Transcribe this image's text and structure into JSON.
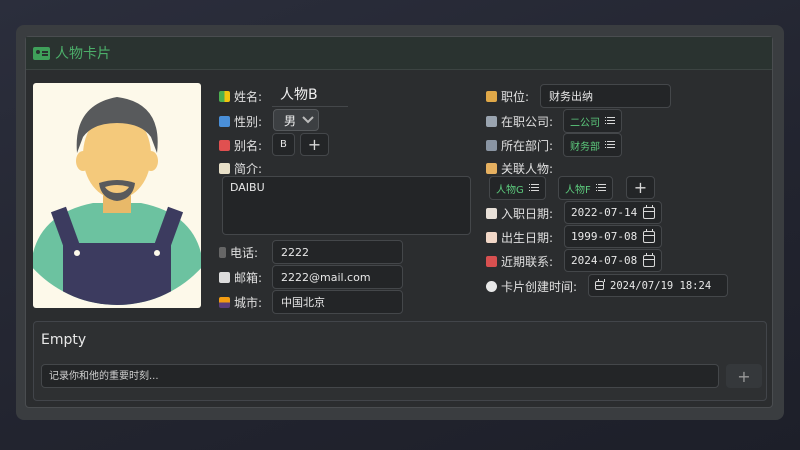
{
  "card": {
    "title": "人物卡片"
  },
  "left": {
    "name_label": "姓名:",
    "name_value": "人物B",
    "gender_label": "性别:",
    "gender_value": "男",
    "alias_label": "别名:",
    "alias_tag": "B",
    "intro_label": "简介:",
    "intro_value": "DAIBU",
    "phone_label": "电话:",
    "phone_value": "2222",
    "email_label": "邮箱:",
    "email_value": "2222@mail.com",
    "city_label": "城市:",
    "city_value": "中国北京"
  },
  "right": {
    "position_label": "职位:",
    "position_value": "财务出纳",
    "company_label": "在职公司:",
    "company_tag": "二公司",
    "dept_label": "所在部门:",
    "dept_tag": "财务部",
    "related_label": "关联人物:",
    "related_tags": [
      "人物G",
      "人物F"
    ],
    "join_label": "入职日期:",
    "join_value": "2022-07-14",
    "birth_label": "出生日期:",
    "birth_value": "1999-07-08",
    "contact_label": "近期联系:",
    "contact_value": "2024-07-08",
    "created_label": "卡片创建时间:",
    "created_value": "2024/07/19 18:24"
  },
  "timeline": {
    "title": "Empty",
    "placeholder": "记录你和他的重要时刻..."
  },
  "icons": {
    "name": "beginner-badge-icon",
    "gender": "restroom-icon",
    "alias": "calendar-icon",
    "intro": "memo-icon",
    "phone": "pager-icon",
    "email": "envelope-icon",
    "city": "cityscape-icon",
    "position": "person-icon",
    "company": "office-building-icon",
    "dept": "building-icon",
    "related": "person-icon",
    "join": "calendar-pen-icon",
    "birth": "birthday-cake-icon",
    "contact": "calendar-icon",
    "created": "clock-icon"
  },
  "colors": {
    "accent": "#4caf6a",
    "tag_text": "#5cc97c",
    "background": "#2b2d2f"
  }
}
